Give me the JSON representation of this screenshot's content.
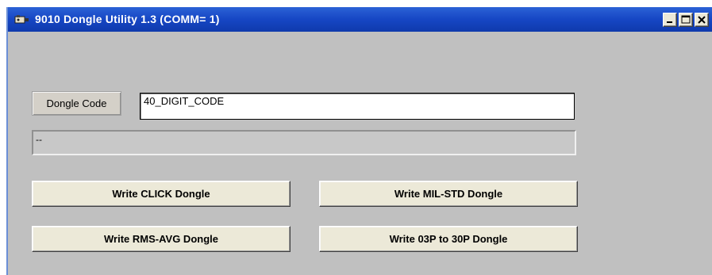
{
  "window": {
    "title": "9010 Dongle Utility 1.3 (COMM= 1)",
    "controls": {
      "minimize": "_",
      "maximize": "□",
      "close": "✕"
    }
  },
  "form": {
    "dongle_code_label": "Dongle Code",
    "dongle_code_value": "40_DIGIT_CODE",
    "status_text": "--"
  },
  "buttons": {
    "write_click": "Write CLICK Dongle",
    "write_mil_std": "Write MIL-STD Dongle",
    "write_rms_avg": "Write RMS-AVG Dongle",
    "write_03p_30p": "Write 03P to 30P Dongle"
  },
  "colors": {
    "titlebar": "#1646c4",
    "window_bg": "#c0c0c0",
    "button_face": "#ece9d8"
  }
}
